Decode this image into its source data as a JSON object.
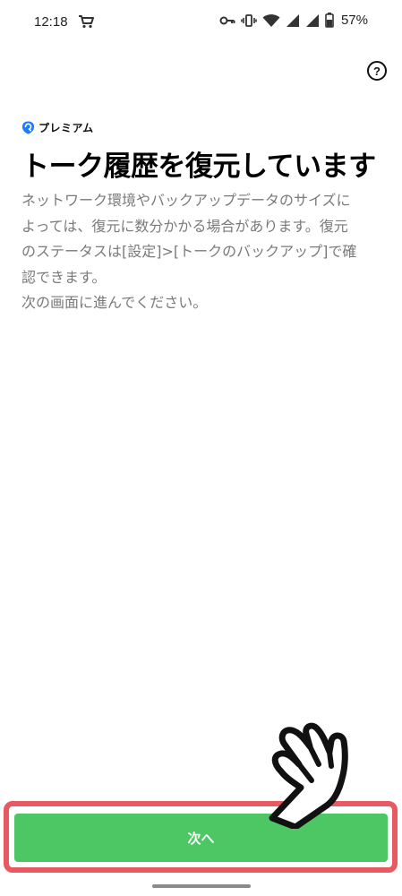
{
  "status_bar": {
    "time": "12:18",
    "battery": "57%"
  },
  "help": {
    "label": "?"
  },
  "premium": {
    "label": "プレミアム",
    "icon": "premium-shield-icon",
    "color": "#1a7cff"
  },
  "title": "トーク履歴を復元しています",
  "description": {
    "lines": [
      "ネットワーク環境やバックアップデータのサイズに",
      "よっては、復元に数分かかる場合があります。復元",
      "のステータスは[設定]>[トークのバックアップ]で確",
      "認できます。",
      "次の画面に進んでください。"
    ]
  },
  "next_button": {
    "label": "次へ",
    "color": "#4cc764"
  },
  "highlight": {
    "color": "#e85a61"
  }
}
